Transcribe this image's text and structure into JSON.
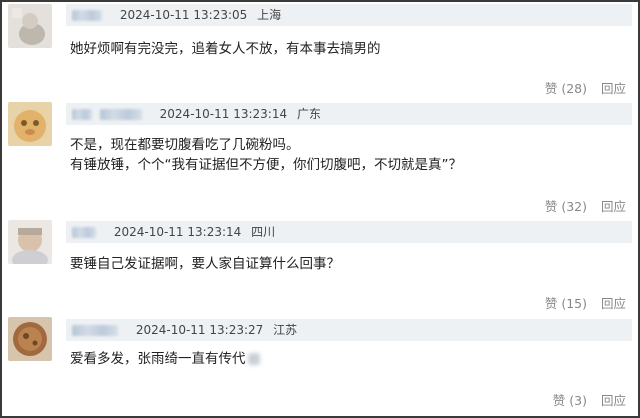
{
  "comments": [
    {
      "timestamp": "2024-10-11 13:23:05",
      "location": "上海",
      "lines": [
        "她好烦啊有完没完，追着女人不放，有本事去搞男的"
      ],
      "like_label": "赞 (28)",
      "reply_label": "回应"
    },
    {
      "timestamp": "2024-10-11 13:23:14",
      "location": "广东",
      "lines": [
        "不是，现在都要切腹看吃了几碗粉吗。",
        "有锤放锤，个个“我有证据但不方便，你们切腹吧，不切就是真”？"
      ],
      "like_label": "赞 (32)",
      "reply_label": "回应"
    },
    {
      "timestamp": "2024-10-11 13:23:14",
      "location": "四川",
      "lines": [
        "要锤自己发证据啊，要人家自证算什么回事？"
      ],
      "like_label": "赞 (15)",
      "reply_label": "回应"
    },
    {
      "timestamp": "2024-10-11 13:23:27",
      "location": "江苏",
      "lines": [
        "爱看多发，张雨绮一直有传代"
      ],
      "like_label": "赞 (3)",
      "reply_label": "回应"
    }
  ]
}
